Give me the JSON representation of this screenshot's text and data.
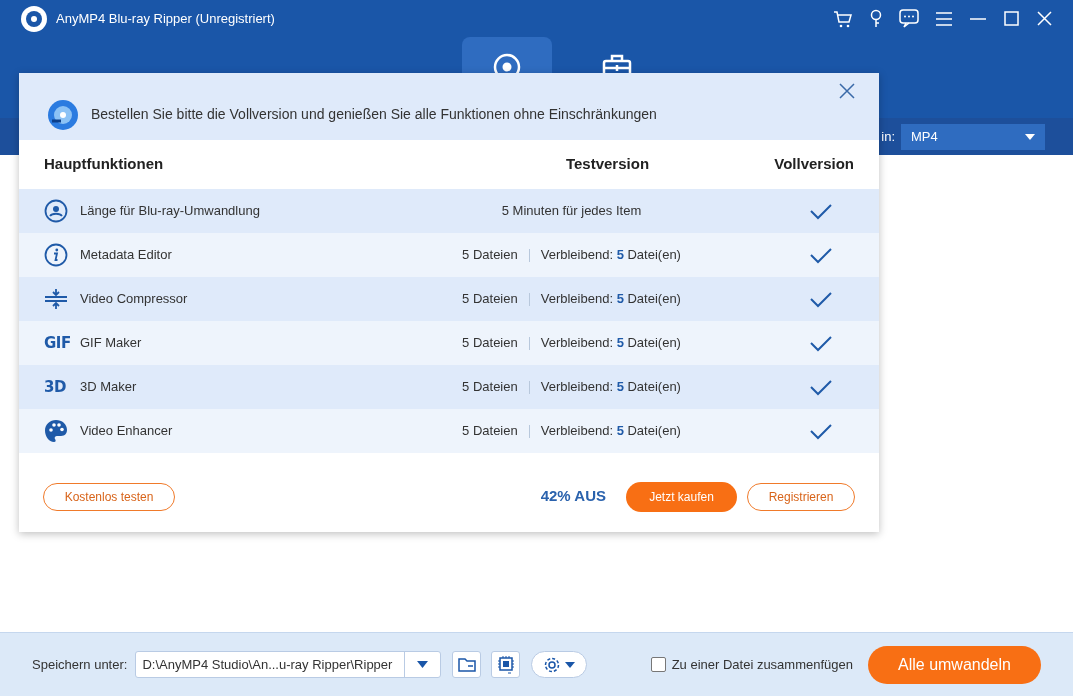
{
  "window": {
    "title": "AnyMP4 Blu-ray Ripper (Unregistriert)"
  },
  "nav_tabs": [
    {
      "selected": true
    },
    {
      "selected": false
    }
  ],
  "toolbar": {
    "format_label": "in:",
    "format_value": "MP4"
  },
  "dialog": {
    "banner": "Bestellen Sie bitte die Vollversion und genießen Sie alle Funktionen ohne Einschränkungen",
    "columns": [
      "Hauptfunktionen",
      "Testversion",
      "Vollversion"
    ],
    "rows": [
      {
        "name": "Länge für Blu-ray-Umwandlung",
        "kind": "text",
        "trial": "5 Minuten für jedes Item",
        "included": true
      },
      {
        "name": "Metadata Editor",
        "kind": "quota",
        "trial": "5 Dateien",
        "remaining": "Verbleibend: **5** Datei(en)",
        "included": true
      },
      {
        "name": "Video Compressor",
        "kind": "quota",
        "trial": "5 Dateien",
        "remaining": "Verbleibend: **5** Datei(en)",
        "included": true
      },
      {
        "badge": "GIF",
        "name": "GIF Maker",
        "kind": "quota",
        "trial": "5 Dateien",
        "remaining": "Verbleibend: **5** Datei(en)",
        "included": true
      },
      {
        "badge": "3D",
        "name": "3D Maker",
        "kind": "quota",
        "trial": "5 Dateien",
        "remaining": "Verbleibend: **5** Datei(en)",
        "included": true
      },
      {
        "name": "Video Enhancer",
        "kind": "quota",
        "trial": "5 Dateien",
        "remaining": "Verbleibend: **5** Datei(en)",
        "included": true
      }
    ],
    "trial_button": "Kostenlos testen",
    "discount": "42% AUS",
    "buy_button": "Jetzt kaufen",
    "register_button": "Registrieren"
  },
  "bottom_bar": {
    "save_label": "Speichern unter:",
    "save_path": "D:\\AnyMP4 Studio\\An...u-ray Ripper\\Ripper",
    "merge_label": "Zu einer Datei zusammenfügen",
    "merge_checked": false,
    "convert_button": "Alle umwandeln"
  }
}
